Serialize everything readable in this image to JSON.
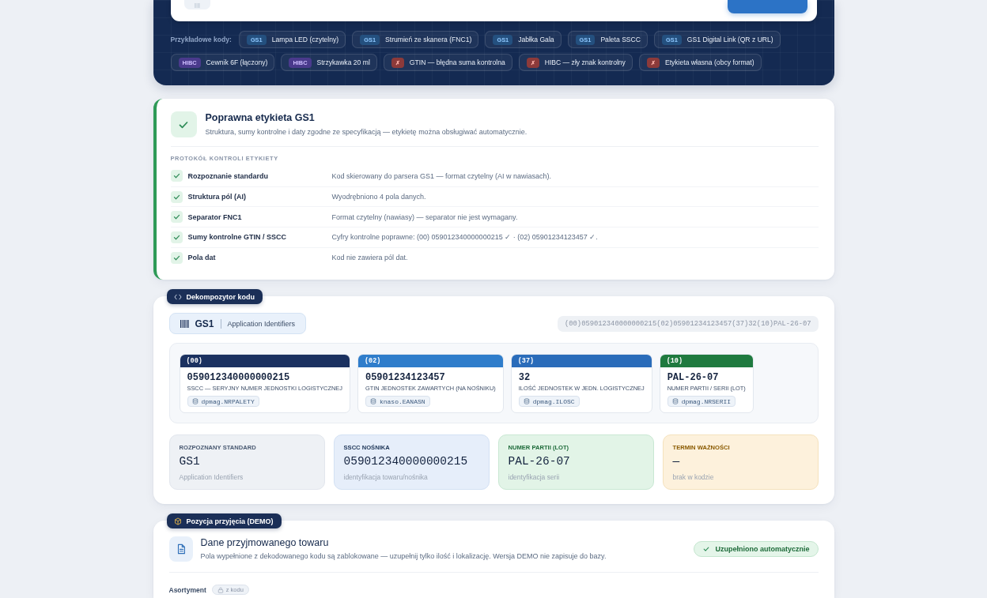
{
  "scanner": {
    "examples_label": "Przykładowe kody:",
    "examples": [
      {
        "kind": "gs1",
        "tag": "GS1",
        "label": "Lampa LED (czytelny)"
      },
      {
        "kind": "gs1",
        "tag": "GS1",
        "label": "Strumień ze skanera (FNC1)"
      },
      {
        "kind": "gs1",
        "tag": "GS1",
        "label": "Jabłka Gala"
      },
      {
        "kind": "gs1",
        "tag": "GS1",
        "label": "Paleta SSCC"
      },
      {
        "kind": "gs1",
        "tag": "GS1",
        "label": "GS1 Digital Link (QR z URL)"
      },
      {
        "kind": "hibc",
        "tag": "HIBC",
        "label": "Cewnik 6F (łączony)"
      },
      {
        "kind": "hibc",
        "tag": "HIBC",
        "label": "Strzykawka 20 ml"
      },
      {
        "kind": "invalid",
        "tag": "✗",
        "label": "GTIN — błędna suma kontrolna"
      },
      {
        "kind": "invalid",
        "tag": "✗",
        "label": "HIBC — zły znak kontrolny"
      },
      {
        "kind": "invalid",
        "tag": "✗",
        "label": "Etykieta własna (obcy format)"
      }
    ]
  },
  "validation": {
    "passed": true,
    "title": "Poprawna etykieta GS1",
    "summary": "Struktura, sumy kontrolne i daty zgodne ze specyfikacją — etykietę można obsługiwać automatycznie.",
    "protocol_title": "PROTOKÓŁ KONTROLI ETYKIETY",
    "checks": [
      {
        "passed": true,
        "label": "Rozpoznanie standardu",
        "detail": "Kod skierowany do parsera GS1 — format czytelny (AI w nawiasach)."
      },
      {
        "passed": true,
        "label": "Struktura pól (AI)",
        "detail": "Wyodrębniono 4 pola danych."
      },
      {
        "passed": true,
        "label": "Separator FNC1",
        "detail": "Format czytelny (nawiasy) — separator nie jest wymagany."
      },
      {
        "passed": true,
        "label": "Sumy kontrolne GTIN / SSCC",
        "detail": "Cyfry kontrolne poprawne: (00) 059012340000000215 ✓ · (02) 05901234123457 ✓."
      },
      {
        "passed": true,
        "label": "Pola dat",
        "detail": "Kod nie zawiera pól dat."
      }
    ]
  },
  "decoder": {
    "section_title": "Dekompozytor kodu",
    "standard": {
      "name": "GS1",
      "description": "Application Identifiers"
    },
    "raw_code": "(00)059012340000000215(02)05901234123457(37)32(10)PAL-26-07",
    "segments": [
      {
        "ai": "(00)",
        "color": "#1b3160",
        "value": "059012340000000215",
        "description": "SSCC — SERYJNY NUMER JEDNOSTKI LOGISTYCZNEJ",
        "field": "dpmag.NRPALETY"
      },
      {
        "ai": "(02)",
        "color": "#2f7dcb",
        "value": "05901234123457",
        "description": "GTIN JEDNOSTEK ZAWARTYCH (NA NOŚNIKU)",
        "field": "knaso.EANASN"
      },
      {
        "ai": "(37)",
        "color": "#2a6cba",
        "value": "32",
        "description": "ILOŚĆ JEDNOSTEK W JEDN. LOGISTYCZNEJ",
        "field": "dpmag.ILOSC"
      },
      {
        "ai": "(10)",
        "color": "#1f7a3f",
        "value": "PAL-26-07",
        "description": "NUMER PARTII / SERII (LOT)",
        "field": "dpmag.NRSERII"
      }
    ],
    "summary": [
      {
        "kind": "neutral",
        "label": "ROZPOZNANY STANDARD",
        "value": "GS1",
        "note": "Application Identifiers"
      },
      {
        "kind": "info",
        "label": "SSCC NOŚNIKA",
        "value": "059012340000000215",
        "note": "identyfikacja towaru/nośnika"
      },
      {
        "kind": "success",
        "label": "NUMER PARTII (LOT)",
        "value": "PAL-26-07",
        "note": "identyfikacja serii"
      },
      {
        "kind": "warning",
        "label": "TERMIN WAŻNOŚCI",
        "value": "—",
        "note": "brak w kodzie"
      }
    ]
  },
  "reception": {
    "section_title": "Pozycja przyjęcia (DEMO)",
    "title": "Dane przyjmowanego towaru",
    "description": "Pola wypełnione z dekodowanego kodu są zablokowane — uzupełnij tylko ilość i lokalizację. Wersja DEMO nie zapisuje do bazy.",
    "status_badge": "Uzupełniono automatycznie",
    "fields": [
      {
        "label": "Asortyment",
        "locked": true,
        "source": "z kodu"
      }
    ]
  }
}
